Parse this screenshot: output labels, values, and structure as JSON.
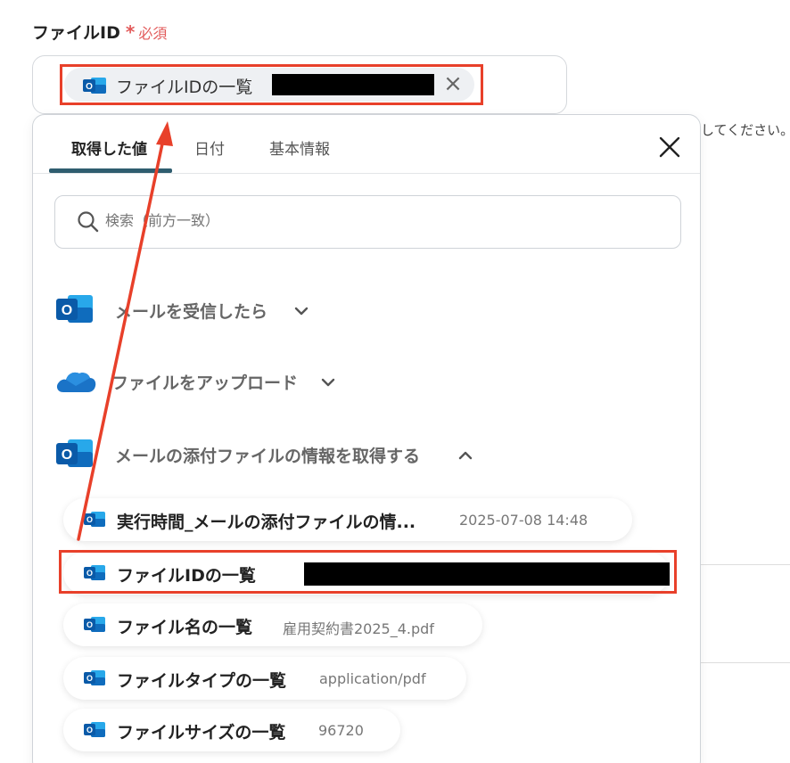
{
  "field": {
    "label": "ファイルID",
    "required_star": "*",
    "required_text": "必須",
    "chip_text": "ファイルIDの一覧",
    "close_glyph": "×"
  },
  "background_hint": "してください。",
  "panel": {
    "tabs": [
      {
        "label": "取得した値",
        "active": true
      },
      {
        "label": "日付",
        "active": false
      },
      {
        "label": "基本情報",
        "active": false
      }
    ],
    "search_placeholder": "検索（前方一致）",
    "groups": [
      {
        "label": "メールを受信したら",
        "icon": "outlook-icon",
        "expanded": false
      },
      {
        "label": "ファイルをアップロード",
        "icon": "onedrive-icon",
        "expanded": false
      },
      {
        "label": "メールの添付ファイルの情報を取得する",
        "icon": "outlook-icon",
        "expanded": true
      }
    ],
    "items": [
      {
        "label": "実行時間_メールの添付ファイルの情...",
        "value": "2025-07-08 14:48"
      },
      {
        "label": "ファイルIDの一覧",
        "value": ""
      },
      {
        "label": "ファイル名の一覧",
        "value": "雇用契約書2025_4.pdf"
      },
      {
        "label": "ファイルタイプの一覧",
        "value": "application/pdf"
      },
      {
        "label": "ファイルサイズの一覧",
        "value": "96720"
      }
    ]
  },
  "colors": {
    "highlight": "#e8402a",
    "required": "#e25a5a",
    "tab_underline": "#2f5d6f",
    "outlook_blue": "#0f6cbd",
    "onedrive_blue": "#1a73c7"
  }
}
